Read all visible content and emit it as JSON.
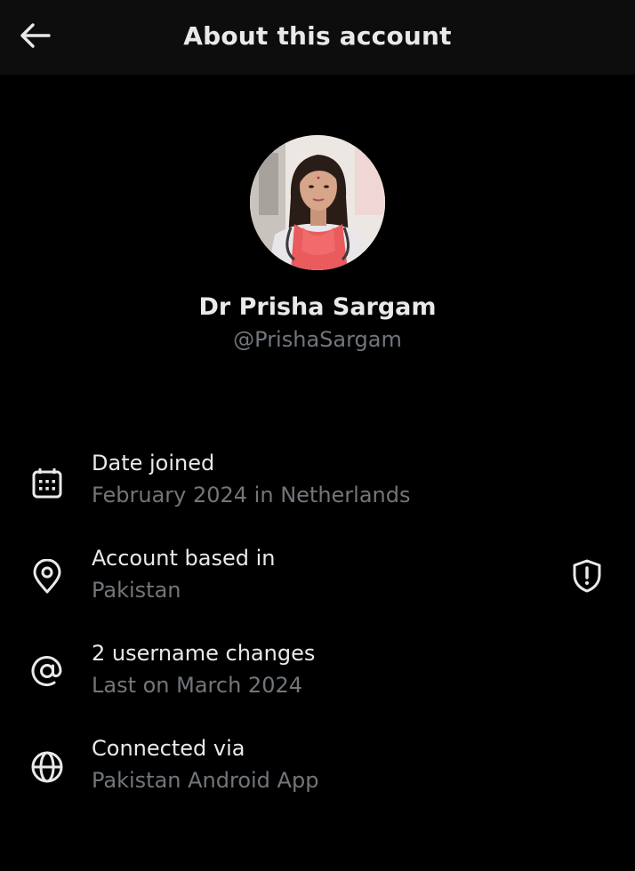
{
  "header": {
    "title": "About this account",
    "back_icon": "arrow-left-icon"
  },
  "profile": {
    "name": "Dr Prisha Sargam",
    "handle": "@PrishaSargam"
  },
  "details": [
    {
      "icon": "calendar-icon",
      "label": "Date joined",
      "value": "February 2024 in Netherlands"
    },
    {
      "icon": "location-pin-icon",
      "label": "Account based in",
      "value": "Pakistan",
      "badge_icon": "shield-alert-icon"
    },
    {
      "icon": "at-sign-icon",
      "label": "2 username changes",
      "value": "Last on March 2024"
    },
    {
      "icon": "globe-icon",
      "label": "Connected via",
      "value": "Pakistan Android App"
    }
  ],
  "colors": {
    "background": "#000000",
    "header_background": "#0d0d0d",
    "primary_text": "#e7e9ea",
    "secondary_text": "#71767b"
  }
}
